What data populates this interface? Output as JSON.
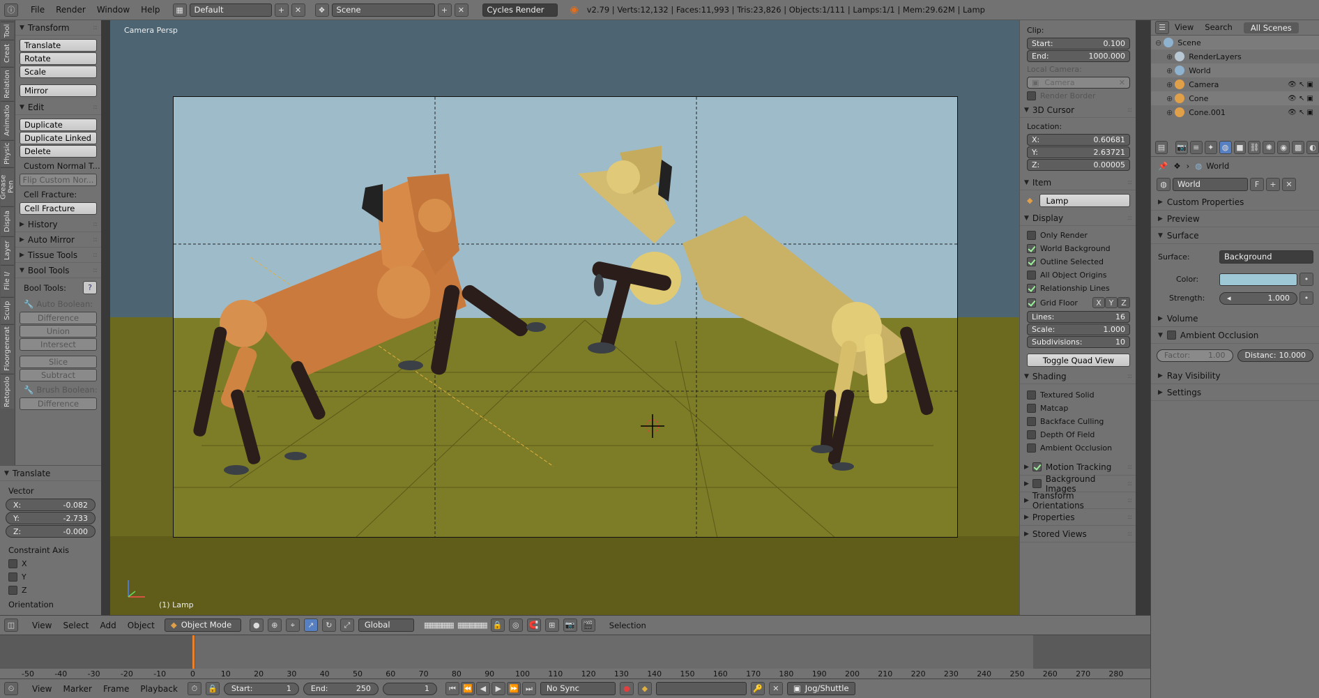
{
  "topbar": {
    "menus": [
      "File",
      "Render",
      "Window",
      "Help"
    ],
    "screen_layout": "Default",
    "scene": "Scene",
    "render_engine": "Cycles Render",
    "stats": "v2.79 | Verts:12,132 | Faces:11,993 | Tris:23,826 | Objects:1/111 | Lamps:1/1 | Mem:29.62M | Lamp"
  },
  "tool_tabs": [
    "Tool",
    "Creat",
    "Relation",
    "Animatio",
    "Physic",
    "Grease Pen",
    "Displa",
    "Layer",
    "File I/",
    "Sculp",
    "Floorgenerat",
    "Retopolo"
  ],
  "toolshelf": {
    "transform": {
      "title": "Transform",
      "buttons": [
        "Translate",
        "Rotate",
        "Scale",
        "Mirror"
      ]
    },
    "edit": {
      "title": "Edit",
      "buttons": [
        "Duplicate",
        "Duplicate Linked",
        "Delete"
      ],
      "custom_normal": "Custom Normal T...",
      "flip_custom": "Flip Custom Nor...",
      "cell_fracture_label": "Cell Fracture:",
      "cell_fracture_btn": "Cell Fracture"
    },
    "history": "History",
    "auto_mirror": "Auto Mirror",
    "tissue_tools": "Tissue Tools",
    "bool_tools": {
      "title": "Bool Tools",
      "label": "Bool Tools:",
      "auto_boolean": "Auto Boolean:",
      "auto_buttons": [
        "Difference",
        "Union",
        "Intersect"
      ],
      "slice_buttons": [
        "Slice",
        "Subtract"
      ],
      "brush_boolean": "Brush Boolean:",
      "brush_buttons": [
        "Difference"
      ]
    }
  },
  "redo_panel": {
    "title": "Translate",
    "vector_label": "Vector",
    "vector": [
      {
        "axis": "X:",
        "value": "-0.082"
      },
      {
        "axis": "Y:",
        "value": "-2.733"
      },
      {
        "axis": "Z:",
        "value": "-0.000"
      }
    ],
    "constraint_label": "Constraint Axis",
    "constraint_axes": [
      "X",
      "Y",
      "Z"
    ],
    "orientation_label": "Orientation"
  },
  "viewport": {
    "corner_label": "Camera Persp",
    "object_label": "(1) Lamp"
  },
  "npanel": {
    "clip_label": "Clip:",
    "clip_start": {
      "label": "Start:",
      "value": "0.100"
    },
    "clip_end": {
      "label": "End:",
      "value": "1000.000"
    },
    "local_camera_label": "Local Camera:",
    "local_camera_value": "Camera",
    "render_border": "Render Border",
    "cursor_title": "3D Cursor",
    "location_label": "Location:",
    "cursor": [
      {
        "axis": "X:",
        "value": "0.60681"
      },
      {
        "axis": "Y:",
        "value": "2.63721"
      },
      {
        "axis": "Z:",
        "value": "0.00005"
      }
    ],
    "item_title": "Item",
    "item_name": "Lamp",
    "display_title": "Display",
    "display_options": [
      {
        "label": "Only Render",
        "checked": false
      },
      {
        "label": "World Background",
        "checked": true
      },
      {
        "label": "Outline Selected",
        "checked": true
      },
      {
        "label": "All Object Origins",
        "checked": false
      },
      {
        "label": "Relationship Lines",
        "checked": true
      }
    ],
    "grid_floor": {
      "label": "Grid Floor",
      "checked": true,
      "axes": [
        "X",
        "Y",
        "Z"
      ]
    },
    "grid_fields": [
      {
        "label": "Lines:",
        "value": "16"
      },
      {
        "label": "Scale:",
        "value": "1.000"
      },
      {
        "label": "Subdivisions:",
        "value": "10"
      }
    ],
    "toggle_quad": "Toggle Quad View",
    "shading_title": "Shading",
    "shading_options": [
      "Textured Solid",
      "Matcap",
      "Backface Culling",
      "Depth Of Field",
      "Ambient Occlusion"
    ],
    "collapsed_panels": [
      {
        "label": "Motion Tracking",
        "checkbox": true,
        "checked": true
      },
      {
        "label": "Background Images",
        "checkbox": true,
        "checked": false
      },
      {
        "label": "Transform Orientations",
        "checkbox": false
      },
      {
        "label": "Properties",
        "checkbox": false
      },
      {
        "label": "Stored Views",
        "checkbox": false
      }
    ]
  },
  "outliner": {
    "header": [
      "View",
      "Search",
      "All Scenes"
    ],
    "rows": [
      {
        "name": "Scene",
        "color": "#8fb2cf"
      },
      {
        "name": "RenderLayers",
        "color": "#b8c7d4"
      },
      {
        "name": "World",
        "color": "#8fb2cf"
      },
      {
        "name": "Camera",
        "color": "#e0a04a"
      },
      {
        "name": "Cone",
        "color": "#e0a04a"
      },
      {
        "name": "Cone.001",
        "color": "#e0a04a"
      }
    ]
  },
  "properties": {
    "breadcrumb": "World",
    "world_name": "World",
    "world_flag": "F",
    "panels_before": [
      "Custom Properties",
      "Preview"
    ],
    "surface_title": "Surface",
    "surface_label": "Surface:",
    "surface_value": "Background",
    "color_label": "Color:",
    "color_value": "#9ec8d6",
    "strength_label": "Strength:",
    "strength_value": "1.000",
    "volume": "Volume",
    "ao_title": "Ambient Occlusion",
    "factor_label": "Factor:",
    "factor_value": "1.00",
    "distance_label": "Distanc:",
    "distance_value": "10.000",
    "panels_after": [
      "Ray Visibility",
      "Settings"
    ]
  },
  "header3d": {
    "menus": [
      "View",
      "Select",
      "Add",
      "Object"
    ],
    "mode": "Object Mode",
    "orientation": "Global",
    "status": "Selection"
  },
  "timeline": {
    "ticks": [
      "-50",
      "-40",
      "-30",
      "-20",
      "-10",
      "0",
      "10",
      "20",
      "30",
      "40",
      "50",
      "60",
      "70",
      "80",
      "90",
      "100",
      "110",
      "120",
      "130",
      "140",
      "150",
      "160",
      "170",
      "180",
      "190",
      "200",
      "210",
      "220",
      "230",
      "240",
      "250",
      "260",
      "270",
      "280"
    ],
    "current_frame_value": 0
  },
  "timeline_header": {
    "menus": [
      "View",
      "Marker",
      "Frame",
      "Playback"
    ],
    "start": {
      "label": "Start:",
      "value": "1"
    },
    "end": {
      "label": "End:",
      "value": "250"
    },
    "current": "1",
    "sync": "No Sync",
    "jog": "Jog/Shuttle"
  },
  "colors": {
    "sky": "#9ebbc9",
    "ground": "#7e7d27",
    "horse_left": "#c97a3c",
    "horse_right": "#c9b166",
    "leg": "#2a1d1a",
    "panel": "#727272",
    "frame_cursor": "#e8822e"
  }
}
